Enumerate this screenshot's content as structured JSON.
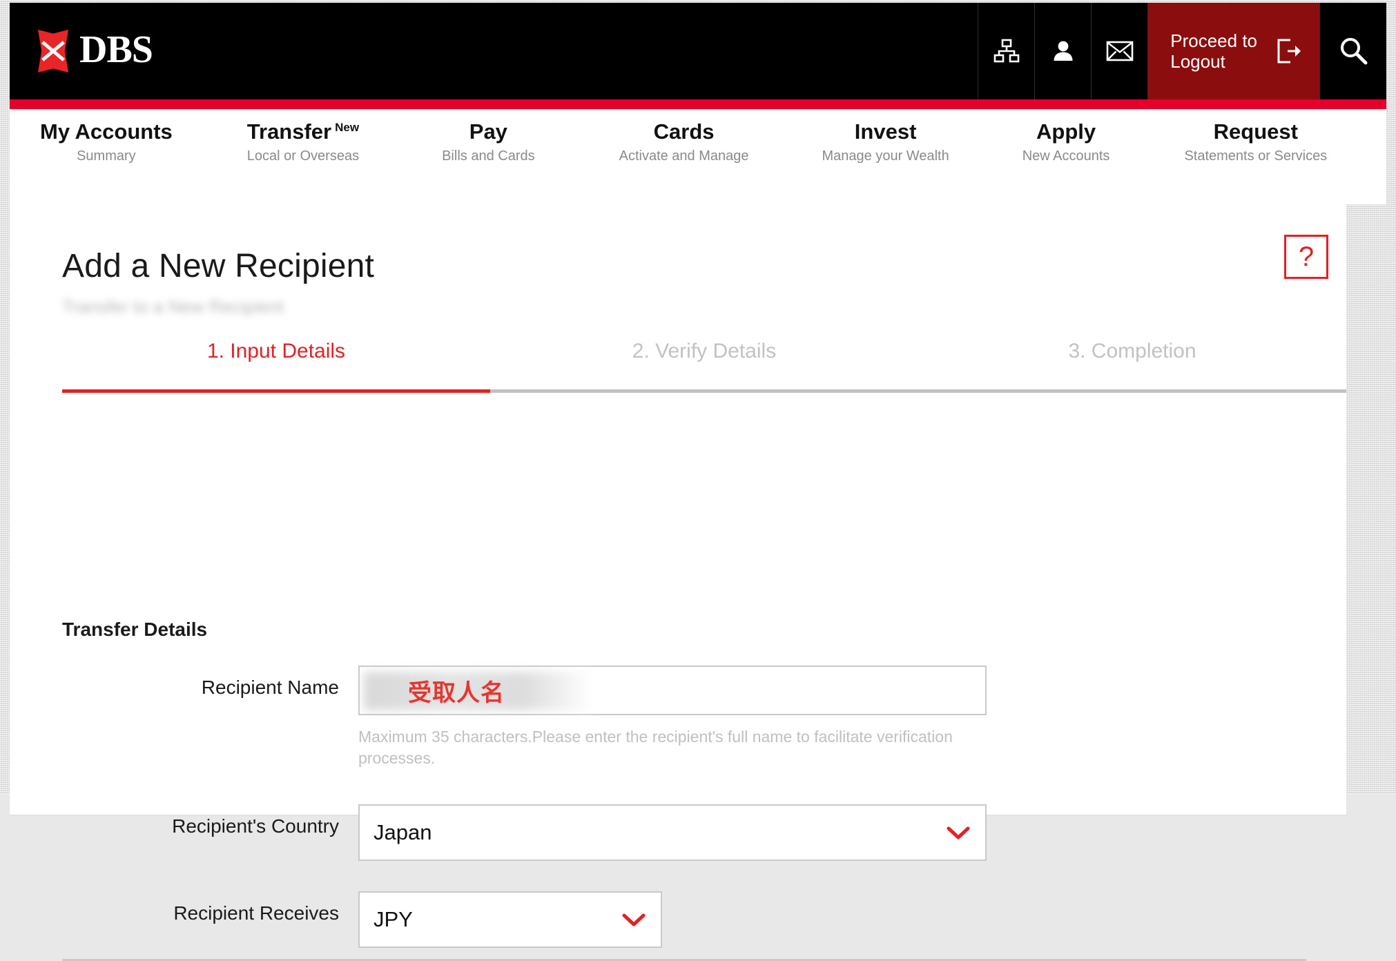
{
  "header": {
    "logo_text": "DBS",
    "logo_icon": "dbs-diamond-logo",
    "icons": [
      {
        "name": "sitemap-icon",
        "glyph": "sitemap"
      },
      {
        "name": "user-profile-icon",
        "glyph": "person"
      },
      {
        "name": "mail-icon",
        "glyph": "envelope"
      }
    ],
    "logout_label": "Proceed to\nLogout",
    "logout_icon": "logout-icon",
    "search_icon": "search-icon",
    "accent_red": "#e4002b",
    "logout_bg": "#8c0d0d"
  },
  "nav": {
    "items": [
      {
        "title": "My Accounts",
        "subtitle": "Summary",
        "badge": ""
      },
      {
        "title": "Transfer",
        "subtitle": "Local or Overseas",
        "badge": "New"
      },
      {
        "title": "Pay",
        "subtitle": "Bills and Cards",
        "badge": ""
      },
      {
        "title": "Cards",
        "subtitle": "Activate and Manage",
        "badge": ""
      },
      {
        "title": "Invest",
        "subtitle": "Manage your Wealth",
        "badge": ""
      },
      {
        "title": "Apply",
        "subtitle": "New Accounts",
        "badge": ""
      },
      {
        "title": "Request",
        "subtitle": "Statements or Services",
        "badge": ""
      }
    ]
  },
  "page": {
    "title": "Add a New Recipient",
    "subtitle_redacted": "Transfer to a New Recipient",
    "help_button_label": "?"
  },
  "steps": {
    "items": [
      {
        "label": "1. Input Details",
        "state": "active"
      },
      {
        "label": "2. Verify Details",
        "state": "inactive"
      },
      {
        "label": "3. Completion",
        "state": "inactive"
      }
    ],
    "progress_percent": 33,
    "active_color": "#e32124",
    "inactive_color": "#c2c2c2"
  },
  "form": {
    "section_title": "Transfer Details",
    "recipient_name": {
      "label": "Recipient Name",
      "value": "受取人名",
      "placeholder": "",
      "helper": "Maximum 35 characters.Please enter the recipient's full name to facilitate verification processes."
    },
    "recipient_country": {
      "label": "Recipient's Country",
      "value": "Japan",
      "chevron_icon": "chevron-down-icon"
    },
    "recipient_receives": {
      "label": "Recipient Receives",
      "value": "JPY",
      "chevron_icon": "chevron-down-icon"
    }
  }
}
